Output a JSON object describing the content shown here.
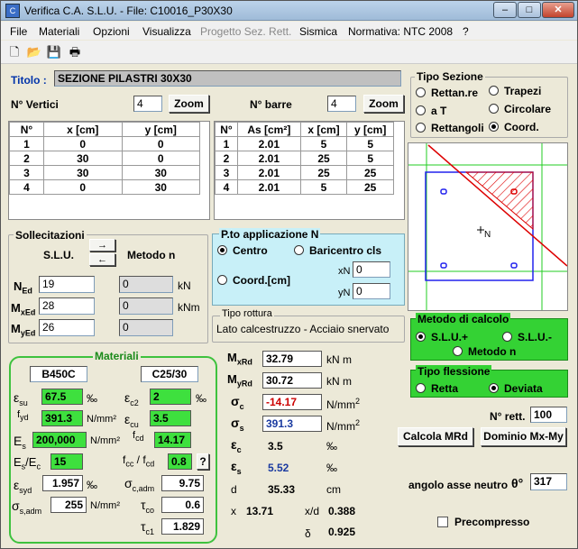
{
  "window": {
    "title": "Verifica C.A. S.L.U. - File: C10016_P30X30",
    "icon": "app-icon",
    "minimize": "–",
    "maximize": "□",
    "close": "✕"
  },
  "menu": [
    "File",
    "Materiali",
    "Opzioni",
    "Visualizza",
    "Progetto Sez. Rett.",
    "Sismica",
    "Normativa: NTC 2008",
    "?"
  ],
  "toolbar": {
    "new": "🗋",
    "open": "📂",
    "save": "💾",
    "print": "🖶"
  },
  "titolo": {
    "label": "Titolo :",
    "value": "SEZIONE PILASTRI 30X30"
  },
  "vertici": {
    "label": "N° Vertici",
    "value": "4",
    "zoom": "Zoom",
    "headers": [
      "N°",
      "x [cm]",
      "y [cm]"
    ],
    "rows": [
      [
        "1",
        "0",
        "0"
      ],
      [
        "2",
        "30",
        "0"
      ],
      [
        "3",
        "30",
        "30"
      ],
      [
        "4",
        "0",
        "30"
      ]
    ]
  },
  "barre": {
    "label": "N° barre",
    "value": "4",
    "zoom": "Zoom",
    "headers": [
      "N°",
      "As [cm²]",
      "x [cm]",
      "y [cm]"
    ],
    "rows": [
      [
        "1",
        "2.01",
        "5",
        "5"
      ],
      [
        "2",
        "2.01",
        "25",
        "5"
      ],
      [
        "3",
        "2.01",
        "25",
        "25"
      ],
      [
        "4",
        "2.01",
        "5",
        "25"
      ]
    ]
  },
  "tipo_sezione": {
    "title": "Tipo Sezione",
    "options": [
      "Rettan.re",
      "Trapezi",
      "a T",
      "Circolare",
      "Rettangoli",
      "Coord."
    ],
    "selected": "Coord."
  },
  "section_view": {
    "neutral_label": "N"
  },
  "sollecitazioni": {
    "title": "Sollecitazioni",
    "slu": "S.L.U.",
    "metodo": "Metodo n",
    "NEd": "19",
    "MxEd": "28",
    "MyEd": "26",
    "n1": "0",
    "n2": "0",
    "n3": "0",
    "unit_kN": "kN",
    "unit_kNm": "kNm",
    "arrow_right": "→",
    "arrow_left": "←"
  },
  "applicazione": {
    "title": "P.to applicazione N",
    "centro": "Centro",
    "baricentro": "Baricentro cls",
    "coord": "Coord.[cm]",
    "xN_label": "xN",
    "yN_label": "yN",
    "xN": "0",
    "yN": "0"
  },
  "tipo_rottura": {
    "title": "Tipo rottura",
    "value": "Lato calcestruzzo - Acciaio snervato"
  },
  "metodo_calcolo": {
    "title": "Metodo di calcolo",
    "options": [
      "S.L.U.+",
      "S.L.U.-",
      "Metodo n"
    ],
    "selected": "S.L.U.+"
  },
  "tipo_flessione": {
    "title": "Tipo flessione",
    "options": [
      "Retta",
      "Deviata"
    ],
    "selected": "Deviata"
  },
  "materiali": {
    "title": "Materiali",
    "steel": "B450C",
    "concrete": "C25/30",
    "esu": "67.5",
    "ec2": "2",
    "fyd": "391.3",
    "ecu": "3.5",
    "Es": "200,000",
    "fcd": "14.17",
    "EsEc": "15",
    "fccfcd": "0.8",
    "esyd": "1.957",
    "sc_adm": "9.75",
    "ss_adm": "255",
    "tco": "0.6",
    "tc1": "1.829",
    "q": "?",
    "u_permil": "‰",
    "u_Nmm2": "N/mm²"
  },
  "results": {
    "MxRd": "32.79",
    "MyRd": "30.72",
    "sigma_c": "-14.17",
    "sigma_s": "391.3",
    "eps_c": "3.5",
    "eps_s": "5.52",
    "d": "35.33",
    "x": "13.71",
    "xd": "0.388",
    "delta": "0.925",
    "u_kNm": "kN m",
    "u_Nmm2": "N/mm",
    "u_permil": "‰",
    "u_cm": "cm"
  },
  "nrett": {
    "label": "N° rett.",
    "value": "100"
  },
  "buttons": {
    "calcola": "Calcola MRd",
    "dominio": "Dominio Mx-My"
  },
  "angolo": {
    "label": "angolo asse neutro",
    "symbol": "θ°",
    "value": "317"
  },
  "precompresso": {
    "label": "Precompresso"
  },
  "colors": {
    "green": "#34d234",
    "cyan": "#c8f0f8",
    "red_value": "#cc0000",
    "blue_value": "#1a3aa0"
  }
}
